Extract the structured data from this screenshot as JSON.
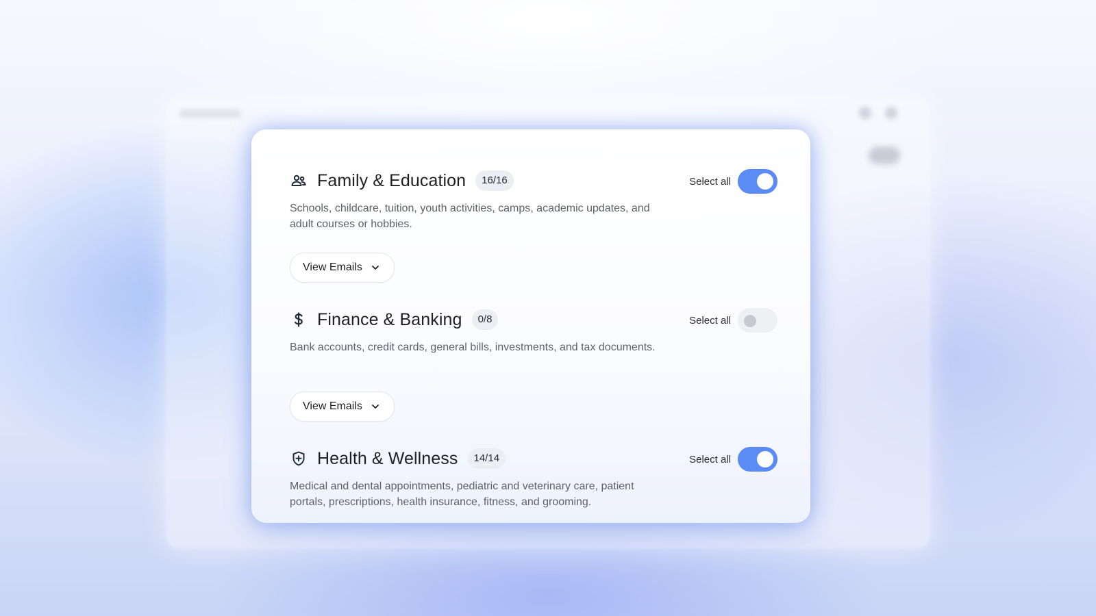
{
  "categories": [
    {
      "title": "Family & Education",
      "icon": "family-icon",
      "count": "16/16",
      "description": "Schools, childcare, tuition, youth activities, camps, academic updates, and adult courses or hobbies.",
      "select_all_label": "Select all",
      "select_all_on": true,
      "view_button_label": "View Emails"
    },
    {
      "title": "Finance & Banking",
      "icon": "dollar-icon",
      "count": "0/8",
      "description": "Bank accounts, credit cards, general bills, investments, and tax documents.",
      "select_all_label": "Select all",
      "select_all_on": false,
      "view_button_label": "View Emails"
    },
    {
      "title": "Health & Wellness",
      "icon": "health-shield-icon",
      "count": "14/14",
      "description": "Medical and dental appointments, pediatric and veterinary care, patient portals, prescriptions, health insurance, fitness, and grooming.",
      "select_all_label": "Select all",
      "select_all_on": true
    }
  ],
  "colors": {
    "toggle_on": "#5b8cf5",
    "toggle_off": "#eef0f4",
    "badge_bg": "#eceef3",
    "text_primary": "#1f1f24",
    "text_secondary": "#5f6169"
  }
}
